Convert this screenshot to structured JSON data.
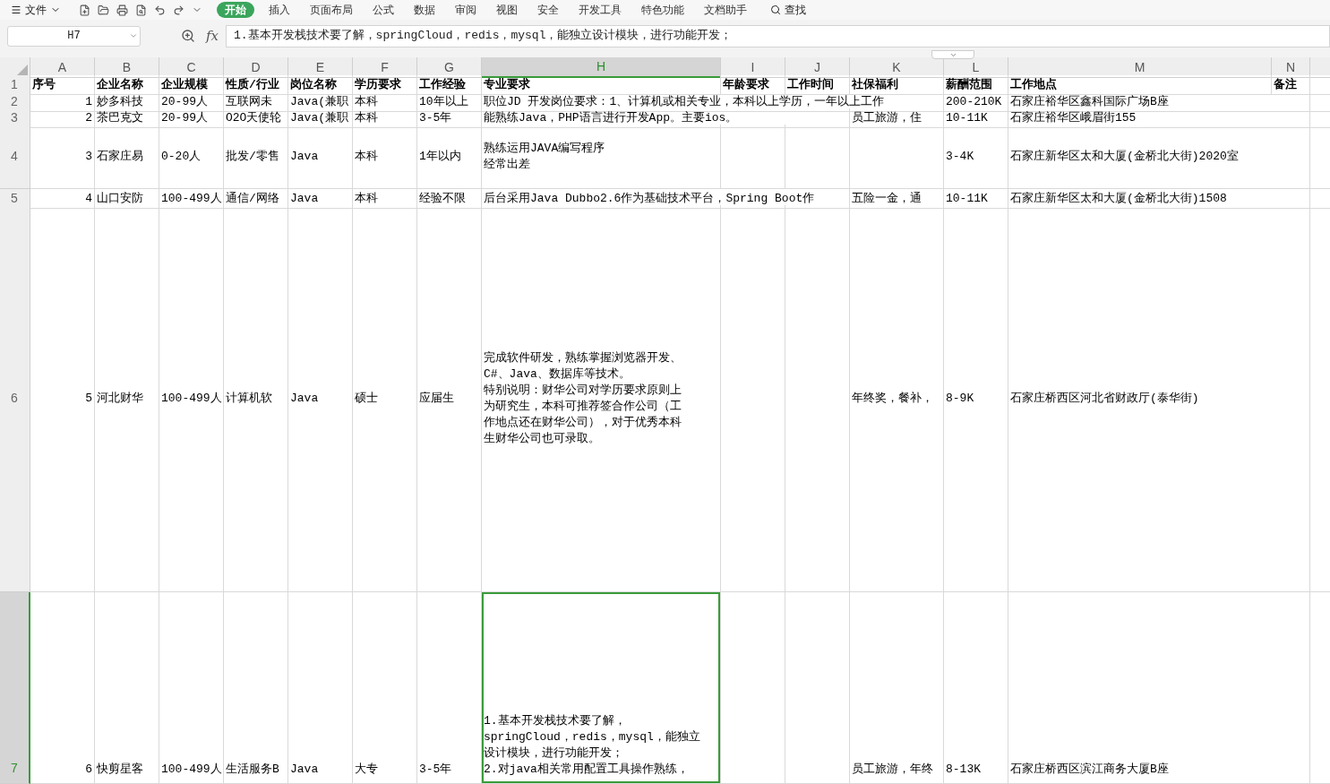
{
  "menu": {
    "file_label": "文件",
    "tabs": [
      {
        "label": "开始",
        "selected": true
      },
      {
        "label": "插入",
        "selected": false
      },
      {
        "label": "页面布局",
        "selected": false
      },
      {
        "label": "公式",
        "selected": false
      },
      {
        "label": "数据",
        "selected": false
      },
      {
        "label": "审阅",
        "selected": false
      },
      {
        "label": "视图",
        "selected": false
      },
      {
        "label": "安全",
        "selected": false
      },
      {
        "label": "开发工具",
        "selected": false
      },
      {
        "label": "特色功能",
        "selected": false
      },
      {
        "label": "文档助手",
        "selected": false
      }
    ],
    "search_label": "查找"
  },
  "formula_bar": {
    "name_box": "H7",
    "fx_label": "fx",
    "formula": "1.基本开发栈技术要了解，springCloud，redis，mysql，能独立设计模块，进行功能开发；"
  },
  "columns": [
    {
      "label": "A",
      "selected": false
    },
    {
      "label": "B",
      "selected": false
    },
    {
      "label": "C",
      "selected": false
    },
    {
      "label": "D",
      "selected": false
    },
    {
      "label": "E",
      "selected": false
    },
    {
      "label": "F",
      "selected": false
    },
    {
      "label": "G",
      "selected": false
    },
    {
      "label": "H",
      "selected": true
    },
    {
      "label": "I",
      "selected": false
    },
    {
      "label": "J",
      "selected": false
    },
    {
      "label": "K",
      "selected": false
    },
    {
      "label": "L",
      "selected": false
    },
    {
      "label": "M",
      "selected": false
    },
    {
      "label": "N",
      "selected": false
    }
  ],
  "rows": [
    {
      "number": "1",
      "kind": "header",
      "selected": false,
      "cells": [
        {
          "kind": "text",
          "text": "序号"
        },
        {
          "kind": "text",
          "text": "企业名称"
        },
        {
          "kind": "text",
          "text": "企业规模"
        },
        {
          "kind": "text",
          "text": "性质/行业"
        },
        {
          "kind": "text",
          "text": "岗位名称"
        },
        {
          "kind": "text",
          "text": "学历要求"
        },
        {
          "kind": "text",
          "text": "工作经验"
        },
        {
          "kind": "text",
          "text": "专业要求"
        },
        {
          "kind": "text",
          "text": "年龄要求"
        },
        {
          "kind": "text",
          "text": "工作时间"
        },
        {
          "kind": "text",
          "text": "社保福利"
        },
        {
          "kind": "text",
          "text": "薪酬范围"
        },
        {
          "kind": "text",
          "text": "工作地点"
        },
        {
          "kind": "text",
          "text": "备注"
        }
      ]
    },
    {
      "number": "2",
      "kind": "data",
      "selected": false,
      "cells": [
        {
          "kind": "number",
          "text": "1"
        },
        {
          "kind": "text",
          "text": "妙多科技"
        },
        {
          "kind": "text",
          "text": "20-99人"
        },
        {
          "kind": "text",
          "text": "互联网未"
        },
        {
          "kind": "text",
          "text": "Java(兼职"
        },
        {
          "kind": "text",
          "text": "本科"
        },
        {
          "kind": "text",
          "text": "10年以上"
        },
        {
          "kind": "text",
          "text": "职位JD 开发岗位要求：1、计算机或相关专业，本科以上学历，一年以上工作"
        },
        {
          "kind": "empty"
        },
        {
          "kind": "empty"
        },
        {
          "kind": "empty"
        },
        {
          "kind": "text",
          "text": "200-210K"
        },
        {
          "kind": "text",
          "text": "石家庄裕华区鑫科国际广场B座"
        },
        {
          "kind": "empty"
        }
      ]
    },
    {
      "number": "3",
      "kind": "data",
      "selected": false,
      "cells": [
        {
          "kind": "number",
          "text": "2"
        },
        {
          "kind": "text",
          "text": "茶巴克文"
        },
        {
          "kind": "text",
          "text": "20-99人"
        },
        {
          "kind": "text",
          "text": "O2O天使轮"
        },
        {
          "kind": "text",
          "text": "Java(兼职"
        },
        {
          "kind": "text",
          "text": "本科"
        },
        {
          "kind": "text",
          "text": "3-5年"
        },
        {
          "kind": "text",
          "text": "能熟练Java，PHP语言进行开发App。主要ios。"
        },
        {
          "kind": "empty"
        },
        {
          "kind": "empty"
        },
        {
          "kind": "text",
          "text": "员工旅游，住"
        },
        {
          "kind": "text",
          "text": "10-11K"
        },
        {
          "kind": "text",
          "text": "石家庄裕华区峨眉街155"
        },
        {
          "kind": "empty"
        }
      ]
    },
    {
      "number": "4",
      "kind": "data",
      "selected": false,
      "cells": [
        {
          "kind": "number",
          "text": "3"
        },
        {
          "kind": "text",
          "text": "石家庄易"
        },
        {
          "kind": "text",
          "text": "0-20人"
        },
        {
          "kind": "text",
          "text": "批发/零售"
        },
        {
          "kind": "text",
          "text": "Java"
        },
        {
          "kind": "text",
          "text": "本科"
        },
        {
          "kind": "text",
          "text": "1年以内"
        },
        {
          "kind": "wrap",
          "lines": [
            "熟练运用JAVA编写程序",
            "经常出差"
          ]
        },
        {
          "kind": "empty"
        },
        {
          "kind": "empty"
        },
        {
          "kind": "empty"
        },
        {
          "kind": "text",
          "text": "3-4K"
        },
        {
          "kind": "text",
          "text": "石家庄新华区太和大厦(金桥北大街)2020室"
        },
        {
          "kind": "empty"
        }
      ]
    },
    {
      "number": "5",
      "kind": "data",
      "selected": false,
      "cells": [
        {
          "kind": "number",
          "text": "4"
        },
        {
          "kind": "text",
          "text": "山口安防"
        },
        {
          "kind": "text",
          "text": "100-499人"
        },
        {
          "kind": "text",
          "text": "通信/网络"
        },
        {
          "kind": "text",
          "text": "Java"
        },
        {
          "kind": "text",
          "text": "本科"
        },
        {
          "kind": "text",
          "text": "经验不限"
        },
        {
          "kind": "text",
          "text": "后台采用Java Dubbo2.6作为基础技术平台，Spring Boot作"
        },
        {
          "kind": "empty"
        },
        {
          "kind": "empty"
        },
        {
          "kind": "text",
          "text": "五险一金，通"
        },
        {
          "kind": "text",
          "text": "10-11K"
        },
        {
          "kind": "text",
          "text": "石家庄新华区太和大厦(金桥北大街)1508"
        },
        {
          "kind": "empty"
        }
      ]
    },
    {
      "number": "6",
      "kind": "data",
      "selected": false,
      "cells": [
        {
          "kind": "number",
          "text": "5"
        },
        {
          "kind": "text",
          "text": "河北财华"
        },
        {
          "kind": "text",
          "text": "100-499人"
        },
        {
          "kind": "text",
          "text": "计算机软"
        },
        {
          "kind": "text",
          "text": "Java"
        },
        {
          "kind": "text",
          "text": "硕士"
        },
        {
          "kind": "text",
          "text": "应届生"
        },
        {
          "kind": "wrap",
          "lines": [
            "完成软件研发，熟练掌握浏览器开发、",
            "C#、Java、数据库等技术。",
            "特别说明：财华公司对学历要求原则上",
            "为研究生，本科可推荐签合作公司（工",
            "作地点还在财华公司），对于优秀本科",
            "生财华公司也可录取。"
          ]
        },
        {
          "kind": "empty"
        },
        {
          "kind": "empty"
        },
        {
          "kind": "text",
          "text": "年终奖，餐补，"
        },
        {
          "kind": "text",
          "text": "8-9K"
        },
        {
          "kind": "text",
          "text": "石家庄桥西区河北省财政厅(泰华街)"
        },
        {
          "kind": "empty"
        }
      ]
    },
    {
      "number": "7",
      "kind": "data",
      "selected": true,
      "cells": [
        {
          "kind": "number",
          "text": "6"
        },
        {
          "kind": "text",
          "text": "快剪星客"
        },
        {
          "kind": "text",
          "text": "100-499人"
        },
        {
          "kind": "text",
          "text": "生活服务B"
        },
        {
          "kind": "text",
          "text": "Java"
        },
        {
          "kind": "text",
          "text": "大专"
        },
        {
          "kind": "text",
          "text": "3-5年"
        },
        {
          "kind": "wrap",
          "lines": [
            "1.基本开发栈技术要了解，",
            "springCloud，redis，mysql，能独立",
            "设计模块，进行功能开发；",
            "2.对java相关常用配置工具操作熟练，"
          ]
        },
        {
          "kind": "empty"
        },
        {
          "kind": "empty"
        },
        {
          "kind": "text",
          "text": "员工旅游，年终"
        },
        {
          "kind": "text",
          "text": "8-13K"
        },
        {
          "kind": "text",
          "text": "石家庄桥西区滨江商务大厦B座"
        },
        {
          "kind": "empty"
        }
      ]
    }
  ]
}
